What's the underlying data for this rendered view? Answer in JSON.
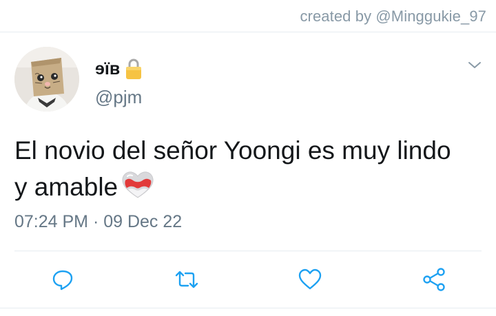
{
  "credit": {
    "text": "created by @Minggukie_97"
  },
  "tweet": {
    "display_name": "ɘïʙ",
    "handle": "@pjm",
    "text": "El novio del señor Yoongi es muy lindo y amable",
    "timestamp": "07:24 PM · 09 Dec 22"
  },
  "icons": {
    "verified_lock": "lock-icon",
    "menu": "chevron-down-icon",
    "emoji": "heart-emoji-white-red",
    "reply": "reply-icon",
    "retweet": "retweet-icon",
    "like": "heart-icon",
    "share": "share-icon"
  },
  "colors": {
    "text_primary": "#14171a",
    "text_secondary": "#657786",
    "icon": "#1da1f2",
    "divider": "#e6ecf0"
  }
}
